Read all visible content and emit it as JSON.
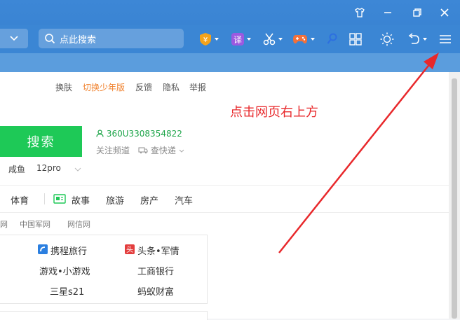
{
  "toolbar": {
    "search_placeholder": "点此搜索"
  },
  "top_links": [
    "换肤",
    "切换少年版",
    "反馈",
    "隐私",
    "举报"
  ],
  "top_links_highlight_color": "#f0802b",
  "annotation": "点击网页右上方",
  "search_button": "搜索",
  "account": "360U3308354822",
  "sub_links": [
    "关注频道",
    "查快递"
  ],
  "keywords": [
    "咸鱼",
    "12pro"
  ],
  "nav": [
    "体育",
    "故事",
    "旅游",
    "房产",
    "汽车"
  ],
  "link_row": [
    "网",
    "中国军网",
    "网信网"
  ],
  "panel_links": [
    [
      "携程旅行",
      "头条•军情"
    ],
    [
      "游戏•小游戏",
      "工商银行"
    ],
    [
      "三星s21",
      "蚂蚁财富"
    ]
  ],
  "colors": {
    "titlebar": "#3d87d6",
    "toolbar": "#3b86d4",
    "subbar": "#5b9ddd",
    "search_button": "#1ec957",
    "annotation": "#e8282b"
  }
}
